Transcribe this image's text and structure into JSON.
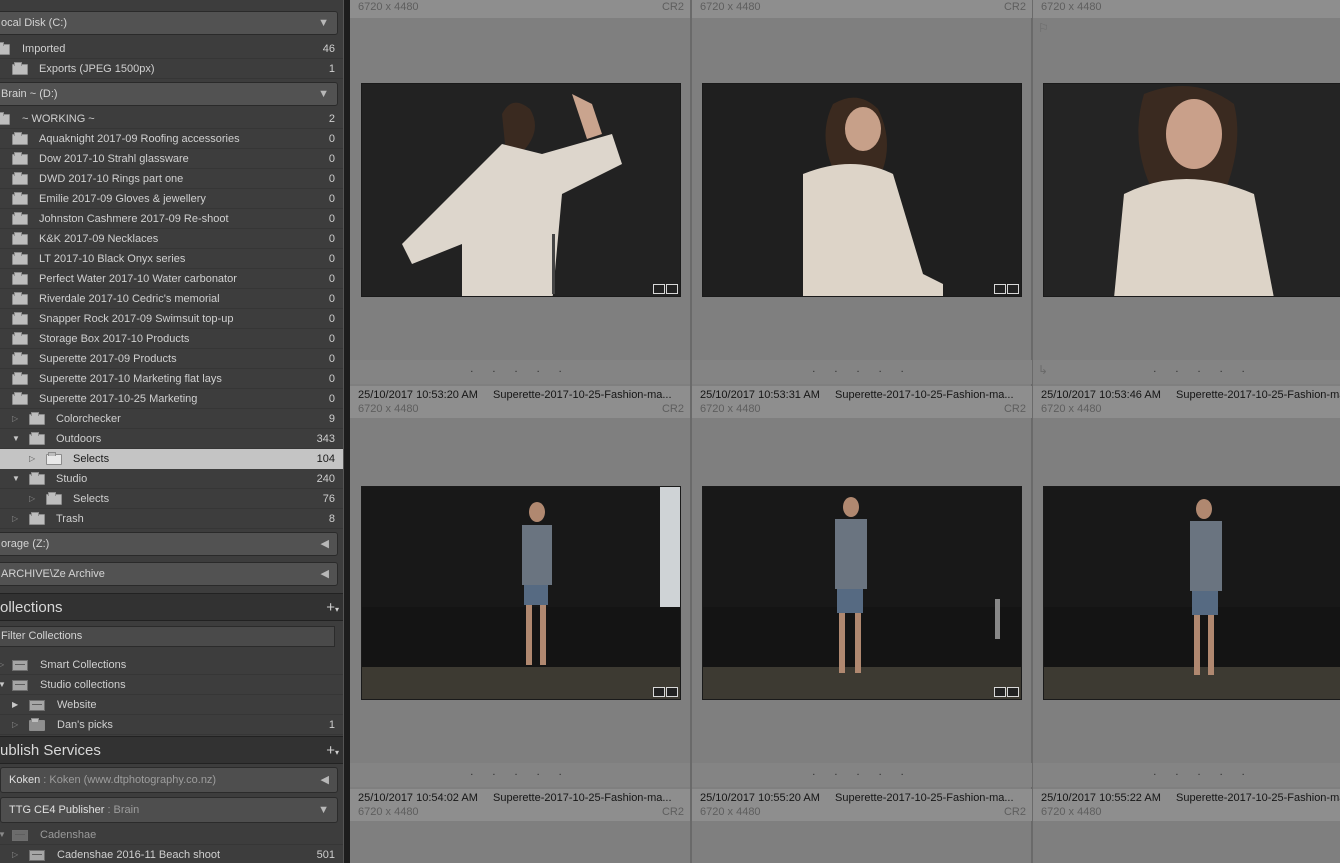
{
  "folders": {
    "volumes": [
      {
        "name": "ocal Disk (C:)",
        "arrow": "▼"
      },
      {
        "name": "Brain ~ (D:)",
        "arrow": "▼"
      },
      {
        "name": "orage (Z:)",
        "arrow": "◀"
      },
      {
        "name": "ARCHIVE\\Ze Archive",
        "arrow": "◀"
      }
    ],
    "items": [
      {
        "label": "Imported",
        "count": "46"
      },
      {
        "label": "Exports (JPEG 1500px)",
        "count": "1"
      },
      {
        "label": "~ WORKING ~",
        "count": "2"
      },
      {
        "label": "Aquaknight 2017-09 Roofing accessories",
        "count": "0"
      },
      {
        "label": "Dow 2017-10 Strahl glassware",
        "count": "0"
      },
      {
        "label": "DWD 2017-10 Rings part one",
        "count": "0"
      },
      {
        "label": "Emilie 2017-09 Gloves & jewellery",
        "count": "0"
      },
      {
        "label": "Johnston Cashmere 2017-09 Re-shoot",
        "count": "0"
      },
      {
        "label": "K&K 2017-09 Necklaces",
        "count": "0"
      },
      {
        "label": "LT 2017-10 Black Onyx series",
        "count": "0"
      },
      {
        "label": "Perfect Water 2017-10 Water carbonator",
        "count": "0"
      },
      {
        "label": "Riverdale 2017-10 Cedric's memorial",
        "count": "0"
      },
      {
        "label": "Snapper Rock 2017-09 Swimsuit top-up",
        "count": "0"
      },
      {
        "label": "Storage Box 2017-10 Products",
        "count": "0"
      },
      {
        "label": "Superette 2017-09 Products",
        "count": "0"
      },
      {
        "label": "Superette 2017-10 Marketing flat lays",
        "count": "0"
      },
      {
        "label": "Superette 2017-10-25 Marketing",
        "count": "0"
      },
      {
        "label": "Colorchecker",
        "count": "9"
      },
      {
        "label": "Outdoors",
        "count": "343"
      },
      {
        "label": "Selects",
        "count": "104"
      },
      {
        "label": "Studio",
        "count": "240"
      },
      {
        "label": "Selects",
        "count": "76"
      },
      {
        "label": "Trash",
        "count": "8"
      }
    ]
  },
  "collections": {
    "title": "ollections",
    "filter_label": "Filter Collections",
    "items": [
      {
        "label": "Smart Collections",
        "count": ""
      },
      {
        "label": "Studio collections",
        "count": ""
      },
      {
        "label": "Website",
        "count": ""
      },
      {
        "label": "Dan's picks",
        "count": "1"
      }
    ]
  },
  "publish": {
    "title": "ublish Services",
    "services": [
      {
        "name": "Koken",
        "sub": ": Koken (www.dtphotography.co.nz)",
        "arrow": "◀"
      },
      {
        "name": "TTG CE4 Publisher",
        "sub": ": Brain",
        "arrow": "▼"
      }
    ],
    "items": [
      {
        "label": "Cadenshae",
        "count": ""
      },
      {
        "label": "Cadenshae 2016-11 Beach shoot",
        "count": "501"
      }
    ]
  },
  "grid": {
    "dots": ". . . . .",
    "top_row": [
      {
        "dims": "6720 x 4480",
        "ext": "CR2"
      },
      {
        "dims": "6720 x 4480",
        "ext": "CR2"
      },
      {
        "dims": "6720 x 4480",
        "ext": ""
      }
    ],
    "cells": [
      {
        "date": "25/10/2017 10:53:20 AM",
        "fname": "Superette-2017-10-25-Fashion-ma...",
        "dims": "6720 x 4480",
        "ext": "CR2"
      },
      {
        "date": "25/10/2017 10:53:31 AM",
        "fname": "Superette-2017-10-25-Fashion-ma...",
        "dims": "6720 x 4480",
        "ext": "CR2"
      },
      {
        "date": "25/10/2017 10:53:46 AM",
        "fname": "Superette-2017-10-25-Fashion-ma...",
        "dims": "6720 x 4480",
        "ext": ""
      },
      {
        "date": "25/10/2017 10:54:02 AM",
        "fname": "Superette-2017-10-25-Fashion-ma...",
        "dims": "6720 x 4480",
        "ext": "CR2"
      },
      {
        "date": "25/10/2017 10:55:20 AM",
        "fname": "Superette-2017-10-25-Fashion-ma...",
        "dims": "6720 x 4480",
        "ext": "CR2"
      },
      {
        "date": "25/10/2017 10:55:22 AM",
        "fname": "Superette-2017-10-25-Fashion-ma...",
        "dims": "6720 x 4480",
        "ext": ""
      }
    ]
  },
  "icons": {
    "flag": "flag-icon",
    "rotate": "rotate-icon",
    "badge": "edit-badge-icon"
  }
}
